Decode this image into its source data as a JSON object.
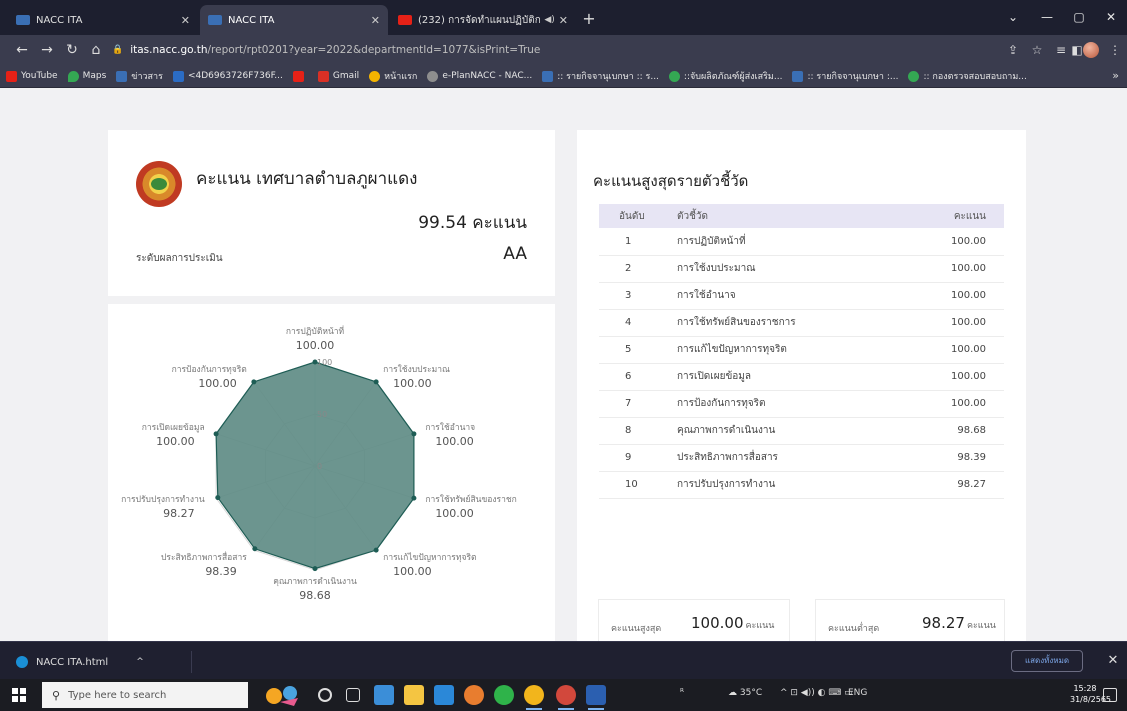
{
  "browser": {
    "tabs": [
      {
        "title": "NACC ITA",
        "active": false
      },
      {
        "title": "NACC ITA",
        "active": true
      },
      {
        "title": "(232) การจัดทำแผนปฏิบัติการตามภารก...",
        "active": false
      }
    ],
    "new_tab": "+",
    "window_controls": [
      "⌄",
      "—",
      "▢",
      "✕"
    ],
    "url_host": "itas.nacc.go.th",
    "url_path": "/report/rpt0201?year=2022&departmentId=1077&isPrint=True",
    "bookmarks": [
      {
        "label": "YouTube",
        "color": "#e62117"
      },
      {
        "label": "Maps",
        "color": "#34a853"
      },
      {
        "label": "ข่าวสาร",
        "color": "#3a6fb5"
      },
      {
        "label": "<4D6963726F736F...",
        "color": "#2b6cc4"
      },
      {
        "label": "",
        "color": "#e62117"
      },
      {
        "label": "Gmail",
        "color": "#d93025"
      },
      {
        "label": "หน้าแรก",
        "color": "#f4b400"
      },
      {
        "label": "e-PlanNACC - NAC...",
        "color": "#8e8e8e"
      },
      {
        "label": ":: รายกิจจานุเบกษา :: ร...",
        "color": "#3a6fb5"
      },
      {
        "label": "::จับผลิตภัณฑ์ผู้ส่งเสริม...",
        "color": "#34a853"
      },
      {
        "label": ":: รายกิจจานุเบกษา :...",
        "color": "#3a6fb5"
      },
      {
        "label": ":: กองตรวจสอบสอบถาม...",
        "color": "#34a853"
      }
    ],
    "bookmarks_more": "»"
  },
  "score_card": {
    "title": "คะแนน เทศบาลตำบลภูผาแดง",
    "score": "99.54 คะแนน",
    "level_label": "ระดับผลการประเมิน",
    "level_value": "AA"
  },
  "chart_data": {
    "type": "radar",
    "categories": [
      "การปฏิบัติหน้าที่",
      "การใช้งบประมาณ",
      "การใช้อำนาจ",
      "การใช้ทรัพย์สินของราชการ",
      "การแก้ไขปัญหาการทุจริต",
      "คุณภาพการดำเนินงาน",
      "ประสิทธิภาพการสื่อสาร",
      "การปรับปรุงการทำงาน",
      "การเปิดเผยข้อมูล",
      "การป้องกันการทุจริต"
    ],
    "axis_labels": [
      "การปฏิบัติหน้าที่",
      "การใช้งบประมาณ",
      "การใช้อำนาจ",
      "การใช้ทรัพย์สินของราชก",
      "การแก้ไขปัญหาการทุจริต",
      "คุณภาพการดำเนินงาน",
      "ประสิทธิภาพการสื่อสาร",
      "การปรับปรุงการทำงาน",
      "การเปิดเผยข้อมูล",
      "การป้องกันการทุจริต"
    ],
    "value_labels": [
      "100.00",
      "100.00",
      "100.00",
      "100.00",
      "100.00",
      "98.68",
      "98.39",
      "98.27",
      "100.00",
      "100.00"
    ],
    "values": [
      100,
      100,
      100,
      100,
      100,
      98.68,
      98.39,
      98.27,
      100,
      100
    ],
    "rlim": [
      0,
      100
    ],
    "ticks": [
      "0",
      "50",
      "100"
    ],
    "fill_color": "#5f8c86",
    "stroke_color": "#1e5d55"
  },
  "top_table": {
    "title": "คะแนนสูงสุดรายตัวชี้วัด",
    "headers": [
      "อันดับ",
      "ตัวชี้วัด",
      "คะแนน"
    ],
    "rows": [
      [
        "1",
        "การปฏิบัติหน้าที่",
        "100.00"
      ],
      [
        "2",
        "การใช้งบประมาณ",
        "100.00"
      ],
      [
        "3",
        "การใช้อำนาจ",
        "100.00"
      ],
      [
        "4",
        "การใช้ทรัพย์สินของราชการ",
        "100.00"
      ],
      [
        "5",
        "การแก้ไขปัญหาการทุจริต",
        "100.00"
      ],
      [
        "6",
        "การเปิดเผยข้อมูล",
        "100.00"
      ],
      [
        "7",
        "การป้องกันการทุจริต",
        "100.00"
      ],
      [
        "8",
        "คุณภาพการดำเนินงาน",
        "98.68"
      ],
      [
        "9",
        "ประสิทธิภาพการสื่อสาร",
        "98.39"
      ],
      [
        "10",
        "การปรับปรุงการทำงาน",
        "98.27"
      ]
    ]
  },
  "summary": {
    "max_label": "คะแนนสูงสุด",
    "max_value": "100.00",
    "max_unit": "คะแนน",
    "min_label": "คะแนนต่ำสุด",
    "min_value": "98.27",
    "min_unit": "คะแนน"
  },
  "download_bar": {
    "file_name": "NACC ITA.html",
    "chevron": "^",
    "show_all": "แสดงทั้งหมด",
    "close": "✕"
  },
  "taskbar": {
    "search_placeholder": "Type here to search",
    "weather": "35°C",
    "language": "ENG",
    "time": "15:28",
    "date": "31/8/2565"
  }
}
